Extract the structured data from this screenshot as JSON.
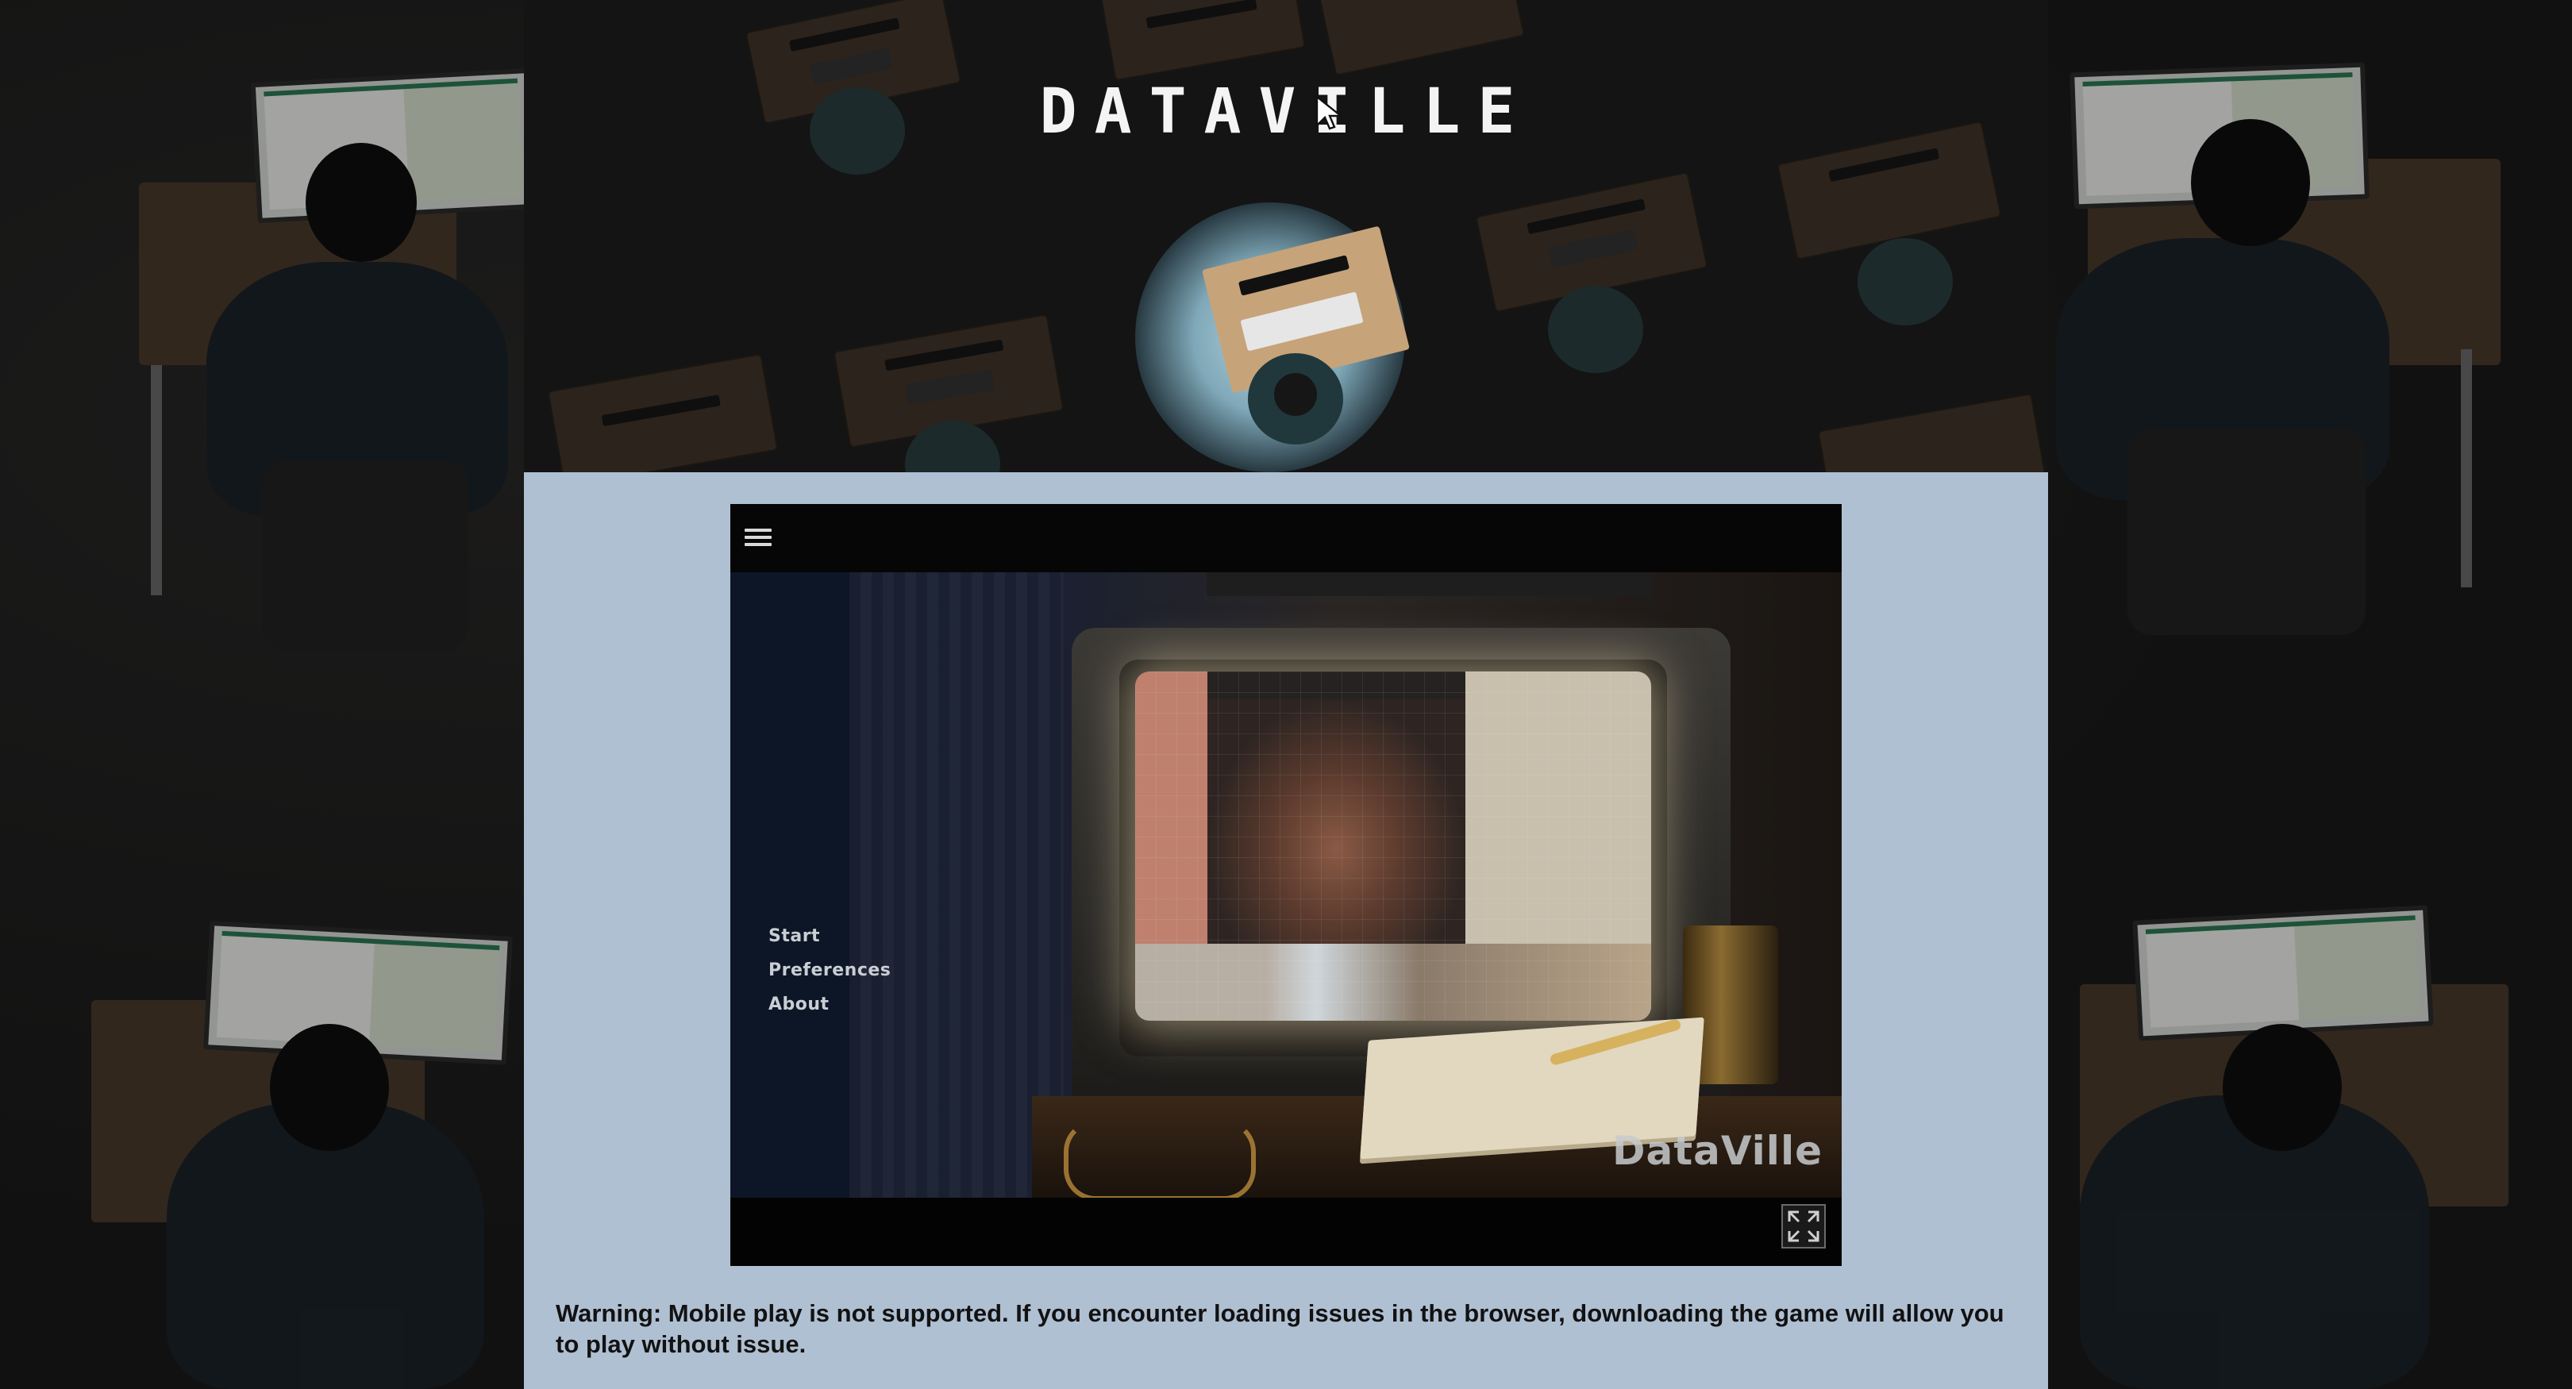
{
  "site": {
    "logo_text": "DATAVILLE"
  },
  "game": {
    "menu": {
      "items": [
        "Start",
        "Preferences",
        "About"
      ]
    },
    "watermark": "DataVille",
    "icons": {
      "menu": "hamburger-menu-icon",
      "fullscreen": "fullscreen-expand-icon"
    }
  },
  "warning_text": "Warning: Mobile play is not supported. If you encounter loading issues in the browser, downloading the game will allow you to play without issue.",
  "colors": {
    "content_bg": "#b0c0d3",
    "game_bg": "#000000",
    "menu_text": "#c9ced4",
    "logo": "#f4f4f4"
  }
}
